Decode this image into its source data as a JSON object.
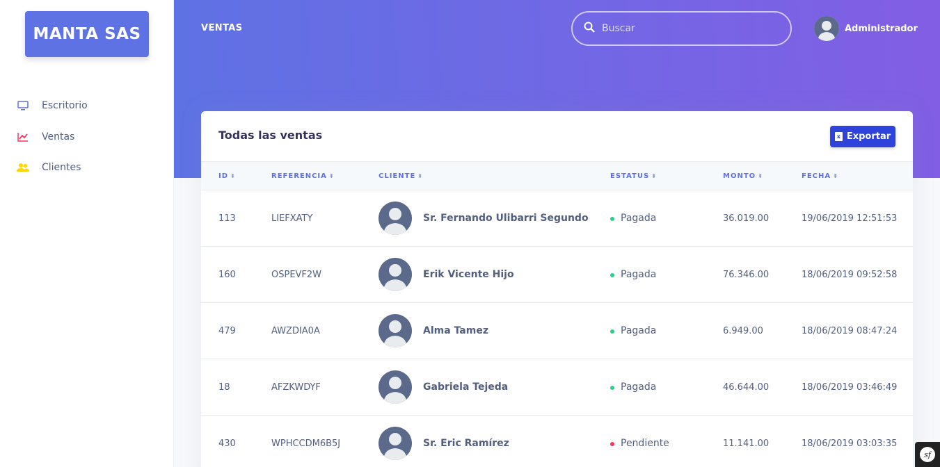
{
  "brand": {
    "name": "MANTA SAS"
  },
  "sidebar": {
    "items": [
      {
        "label": "Escritorio",
        "icon": "monitor-icon",
        "color": "#5e72e4"
      },
      {
        "label": "Ventas",
        "icon": "chart-line-icon",
        "color": "#f5365c"
      },
      {
        "label": "Clientes",
        "icon": "users-icon",
        "color": "#ffd600"
      }
    ]
  },
  "header": {
    "page_title": "VENTAS",
    "search_placeholder": "Buscar",
    "user_name": "Administrador"
  },
  "card": {
    "title": "Todas las ventas",
    "export_label": "Exportar",
    "export_icon_text": "x",
    "sort_glyph": "⬍",
    "columns": [
      "ID",
      "REFERENCIA",
      "CLIENTE",
      "ESTATUS",
      "MONTO",
      "FECHA"
    ],
    "rows": [
      {
        "id": "113",
        "ref": "LIEFXATY",
        "client": "Sr. Fernando Ulibarri Segundo",
        "status": "Pagada",
        "status_color": "#2dce89",
        "amount": "36.019.00",
        "date": "19/06/2019 12:51:53"
      },
      {
        "id": "160",
        "ref": "OSPEVF2W",
        "client": "Erik Vicente Hijo",
        "status": "Pagada",
        "status_color": "#2dce89",
        "amount": "76.346.00",
        "date": "18/06/2019 09:52:58"
      },
      {
        "id": "479",
        "ref": "AWZDIA0A",
        "client": "Alma Tamez",
        "status": "Pagada",
        "status_color": "#2dce89",
        "amount": "6.949.00",
        "date": "18/06/2019 08:47:24"
      },
      {
        "id": "18",
        "ref": "AFZKWDYF",
        "client": "Gabriela Tejeda",
        "status": "Pagada",
        "status_color": "#2dce89",
        "amount": "46.644.00",
        "date": "18/06/2019 03:46:49"
      },
      {
        "id": "430",
        "ref": "WPHCCDM6B5J",
        "client": "Sr. Eric Ramírez",
        "status": "Pendiente",
        "status_color": "#f5365c",
        "amount": "11.141.00",
        "date": "18/06/2019 03:03:35"
      }
    ]
  },
  "debug_toolbar": {
    "icon": "symfony-icon",
    "glyph": "sf"
  }
}
